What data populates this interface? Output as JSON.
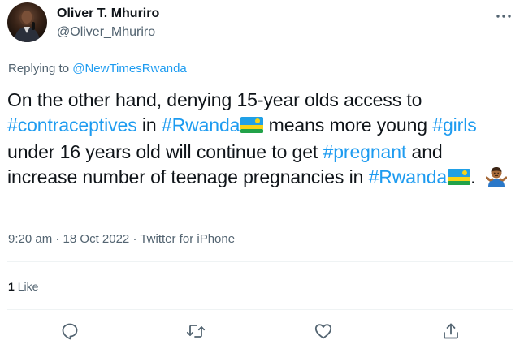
{
  "author": {
    "name": "Oliver T. Mhuriro",
    "handle": "@Oliver_Mhuriro"
  },
  "reply": {
    "prefix": "Replying to",
    "mention": "@NewTimesRwanda"
  },
  "tweet": {
    "t1": "On the other hand, denying 15-year olds access to ",
    "h1": "#contraceptives",
    "t2": " in ",
    "h2": "#Rwanda",
    "t3": " means more young ",
    "h3": "#girls",
    "t4": " under 16 years old will continue to get ",
    "h4": "#pregnant",
    "t5": " and increase number of teenage pregnancies in ",
    "h5": "#Rwanda",
    "t6": ". "
  },
  "meta": {
    "time": "9:20 am",
    "date": "18 Oct 2022",
    "source": "Twitter for iPhone",
    "sep": " · "
  },
  "stats": {
    "likes_count": "1",
    "likes_label": "Like"
  },
  "icons": {
    "more": "more-dots-icon",
    "reply": "reply-bubble-icon",
    "retweet": "retweet-icon",
    "like": "heart-icon",
    "share": "share-icon",
    "flag": "rwanda-flag-emoji",
    "shrug": "person-shrugging-emoji"
  },
  "colors": {
    "link": "#1d9bf0",
    "secondary_text": "#536471",
    "primary_text": "#0f1419",
    "divider": "#eff3f4"
  }
}
